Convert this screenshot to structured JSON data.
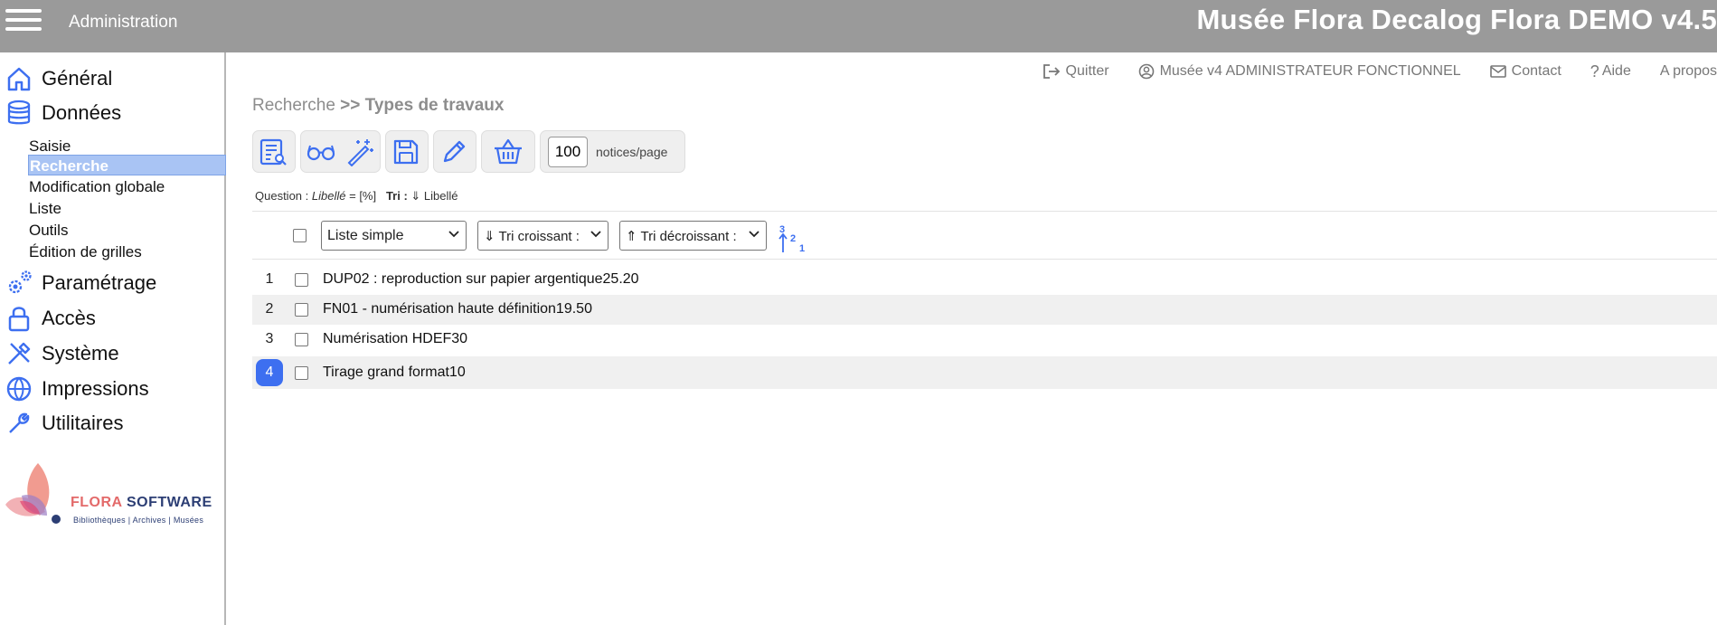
{
  "header": {
    "app_title": "Administration",
    "brand_title": "Musée Flora Decalog Flora DEMO v4.5"
  },
  "sidebar": {
    "main": [
      {
        "label": "Général",
        "icon": "home-icon"
      },
      {
        "label": "Données",
        "icon": "database-icon"
      },
      {
        "label": "Paramétrage",
        "icon": "gears-icon"
      },
      {
        "label": "Accès",
        "icon": "lock-icon"
      },
      {
        "label": "Système",
        "icon": "tools-icon"
      },
      {
        "label": "Impressions",
        "icon": "globe-icon"
      },
      {
        "label": "Utilitaires",
        "icon": "wrench-icon"
      }
    ],
    "donnees_items": [
      {
        "label": "Saisie"
      },
      {
        "label": "Recherche",
        "active": true
      },
      {
        "label": "Modification globale"
      },
      {
        "label": "Liste"
      },
      {
        "label": "Outils"
      },
      {
        "label": "Édition de grilles"
      }
    ],
    "logo": {
      "name_part1": "FLORA",
      "name_part2": "SOFTWARE",
      "tagline": "Bibliothèques | Archives | Musées"
    }
  },
  "toplinks": [
    {
      "label": "Quitter",
      "icon": "logout-icon"
    },
    {
      "label": "Musée v4 ADMINISTRATEUR FONCTIONNEL",
      "icon": "user-icon"
    },
    {
      "label": "Contact",
      "icon": "mail-icon"
    },
    {
      "label": "Aide",
      "icon": "help-icon"
    },
    {
      "label": "A propos",
      "icon": ""
    }
  ],
  "breadcrumb": {
    "parent": "Recherche",
    "separator": ">>",
    "current": "Types de travaux"
  },
  "toolbar": {
    "per_page_value": "100",
    "per_page_label": "notices/page"
  },
  "query": {
    "question_label": "Question :",
    "field": "Libellé",
    "condition": "= [%]",
    "sort_label": "Tri :",
    "sort_value": "⇓ Libellé"
  },
  "controls": {
    "display_select": "Liste simple",
    "sort_asc_select": "⇓ Tri croissant :",
    "sort_desc_select": "⇑ Tri décroissant :"
  },
  "results": [
    {
      "num": "1",
      "text": "DUP02 : reproduction sur papier argentique25.20"
    },
    {
      "num": "2",
      "text": "FN01 - numérisation haute définition19.50"
    },
    {
      "num": "3",
      "text": "Numérisation HDEF30"
    },
    {
      "num": "4",
      "text": "Tirage grand format10"
    }
  ],
  "colors": {
    "header_bg": "#9a9a9a",
    "accent_blue": "#3d6ff0",
    "active_nav_bg": "#a9c4f4"
  }
}
